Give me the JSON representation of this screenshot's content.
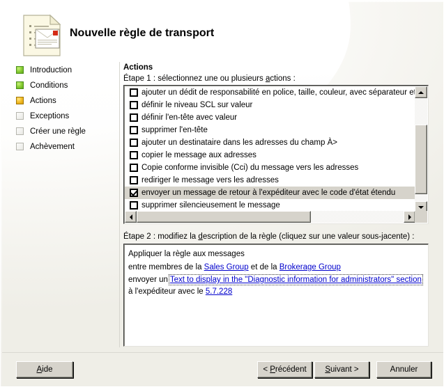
{
  "window": {
    "title": "Nouvelle règle de transport",
    "icon": "document-envelope-icon"
  },
  "sidebar": {
    "items": [
      {
        "label": "Introduction",
        "state": "done"
      },
      {
        "label": "Conditions",
        "state": "done"
      },
      {
        "label": "Actions",
        "state": "current"
      },
      {
        "label": "Exceptions",
        "state": "todo"
      },
      {
        "label": "Créer une règle",
        "state": "todo"
      },
      {
        "label": "Achèvement",
        "state": "todo"
      }
    ]
  },
  "main": {
    "heading": "Actions",
    "step1_label_pre": "Étape 1 : sélectionnez une ou plusieurs ",
    "step1_label_accel": "a",
    "step1_label_post": "ctions :",
    "actions": [
      {
        "label": "ajouter un dédit de responsabilité en police, taille, couleur, avec séparateur et reve",
        "checked": false,
        "selected": false
      },
      {
        "label": "définir le niveau SCL sur valeur",
        "checked": false,
        "selected": false
      },
      {
        "label": "définir l'en-tête avec valeur",
        "checked": false,
        "selected": false
      },
      {
        "label": "supprimer l'en-tête",
        "checked": false,
        "selected": false
      },
      {
        "label": "ajouter un destinataire dans les adresses du champ À>",
        "checked": false,
        "selected": false
      },
      {
        "label": "copier le message aux adresses",
        "checked": false,
        "selected": false
      },
      {
        "label": "Copie conforme invisible (Cci) du message vers les adresses",
        "checked": false,
        "selected": false
      },
      {
        "label": "rediriger le message vers les adresses",
        "checked": false,
        "selected": false
      },
      {
        "label": "envoyer un message de retour à l'expéditeur avec le code d'état étendu",
        "checked": true,
        "selected": true
      },
      {
        "label": "supprimer silencieusement le message",
        "checked": false,
        "selected": false
      }
    ],
    "step2_label_pre": "Étape 2 : modifiez la ",
    "step2_label_accel": "d",
    "step2_label_post": "escription de la règle (cliquez sur une valeur sous-jacente) :",
    "description": {
      "line1": "Appliquer la règle aux messages",
      "line2_pre": "entre membres de la ",
      "line2_link1": "Sales Group",
      "line2_mid": " et de la ",
      "line2_link2": "Brokerage Group",
      "line3_pre": "envoyer un ",
      "line3_link": "Text to display in the \"Diagnostic information for administrators\" section",
      "line3_mid": " à l'expéditeur avec le ",
      "line3_link2": "5.7.228"
    },
    "link_color": "#0000cc"
  },
  "scrollbars": {
    "vertical": {
      "up": "scroll-up-arrow",
      "down": "scroll-down-arrow"
    },
    "horizontal": {
      "left": "scroll-left-arrow",
      "right": "scroll-right-arrow"
    }
  },
  "footer": {
    "help": {
      "pre": "",
      "accel": "A",
      "post": "ide"
    },
    "previous": {
      "pre": "< ",
      "accel": "P",
      "post": "récédent"
    },
    "next": {
      "pre": "",
      "accel": "S",
      "post": "uivant >"
    },
    "cancel": {
      "pre": "",
      "accel": "",
      "post": "Annuler"
    }
  },
  "colors": {
    "face": "#d6d3cb",
    "done": "#8ed13a",
    "current": "#f5c02c",
    "selection": "#d6d3cb"
  }
}
